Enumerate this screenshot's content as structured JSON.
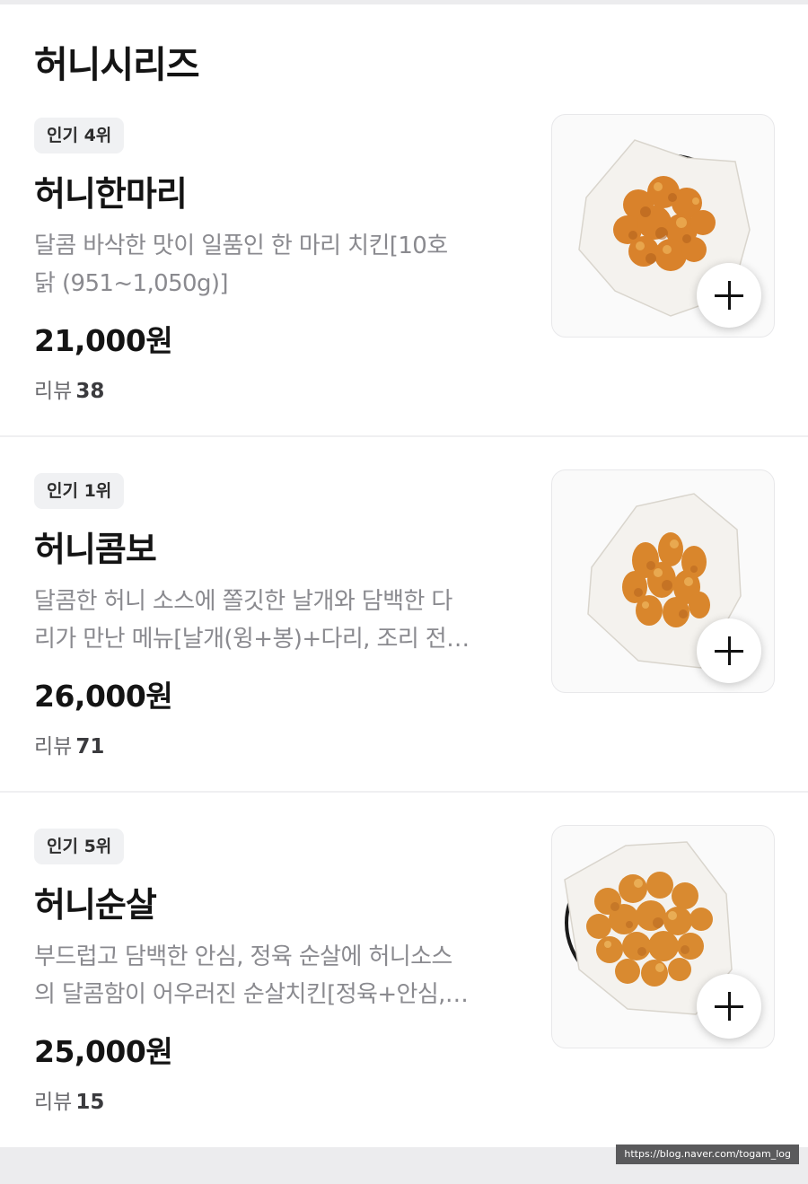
{
  "section": {
    "title": "허니시리즈"
  },
  "items": [
    {
      "badge": "인기 4위",
      "name": "허니한마리",
      "desc_line1": "달콤 바삭한 맛이 일품인 한 마리 치킨[10호",
      "desc_line2": "닭 (951~1,050g)]",
      "price": "21,000원",
      "review_label": "리뷰",
      "review_count": "38",
      "image": "chicken-pieces-basket-image"
    },
    {
      "badge": "인기 1위",
      "name": "허니콤보",
      "desc_line1": "달콤한 허니 소스에 쫄깃한 날개와 담백한 다",
      "desc_line2": "리가 만난 메뉴[날개(윙+봉)+다리, 조리 전…",
      "price": "26,000원",
      "review_label": "리뷰",
      "review_count": "71",
      "image": "chicken-combo-basket-image"
    },
    {
      "badge": "인기 5위",
      "name": "허니순살",
      "desc_line1": "부드럽고 담백한 안심, 정육 순살에 허니소스",
      "desc_line2": "의 달콤함이 어우러진 순살치킨[정육+안심,…",
      "price": "25,000원",
      "review_label": "리뷰",
      "review_count": "15",
      "image": "boneless-chicken-basket-image"
    }
  ],
  "watermark": "https://blog.naver.com/togam_log",
  "colors": {
    "background": "#ffffff",
    "badge_bg": "#f0f1f3",
    "desc_text": "#8a8a8f",
    "outer_bg": "#ececee"
  }
}
